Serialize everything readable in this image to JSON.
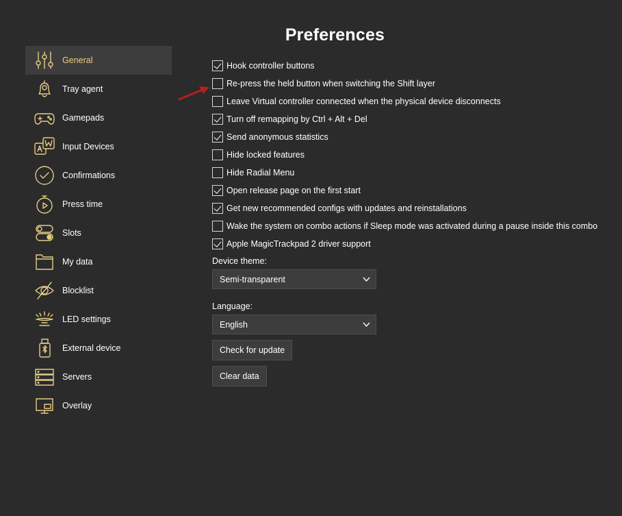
{
  "page": {
    "title": "Preferences"
  },
  "sidebar": {
    "items": [
      {
        "label": "General",
        "icon": "sliders-icon",
        "active": true
      },
      {
        "label": "Tray agent",
        "icon": "bell-icon"
      },
      {
        "label": "Gamepads",
        "icon": "gamepad-icon"
      },
      {
        "label": "Input Devices",
        "icon": "keys-icon"
      },
      {
        "label": "Confirmations",
        "icon": "check-circle-icon"
      },
      {
        "label": "Press time",
        "icon": "stopwatch-icon"
      },
      {
        "label": "Slots",
        "icon": "toggles-icon"
      },
      {
        "label": "My data",
        "icon": "folder-icon"
      },
      {
        "label": "Blocklist",
        "icon": "eye-slash-icon"
      },
      {
        "label": "LED settings",
        "icon": "led-icon"
      },
      {
        "label": "External device",
        "icon": "usb-bluetooth-icon"
      },
      {
        "label": "Servers",
        "icon": "server-icon"
      },
      {
        "label": "Overlay",
        "icon": "monitor-icon"
      }
    ]
  },
  "options": [
    {
      "label": "Hook controller buttons",
      "checked": true
    },
    {
      "label": "Re-press the held button when switching the Shift layer",
      "checked": false
    },
    {
      "label": "Leave Virtual controller connected when the physical device disconnects",
      "checked": false
    },
    {
      "label": "Turn off remapping by Ctrl + Alt + Del",
      "checked": true
    },
    {
      "label": "Send anonymous statistics",
      "checked": true
    },
    {
      "label": "Hide locked features",
      "checked": false
    },
    {
      "label": "Hide Radial Menu",
      "checked": false
    },
    {
      "label": "Open release page on the first start",
      "checked": true
    },
    {
      "label": "Get new recommended configs with updates and reinstallations",
      "checked": true
    },
    {
      "label": "Wake the system on combo actions if Sleep mode was activated during a pause inside this combo",
      "checked": false
    },
    {
      "label": "Apple MagicTrackpad 2 driver support",
      "checked": true
    }
  ],
  "device_theme": {
    "label": "Device theme:",
    "value": "Semi-transparent"
  },
  "language": {
    "label": "Language:",
    "value": "English"
  },
  "buttons": {
    "check_update": "Check for update",
    "clear_data": "Clear data"
  },
  "colors": {
    "accent": "#e6cd85",
    "background": "#2b2b2b",
    "panel": "#3d3d3d",
    "annotation_arrow": "#b3201f"
  }
}
